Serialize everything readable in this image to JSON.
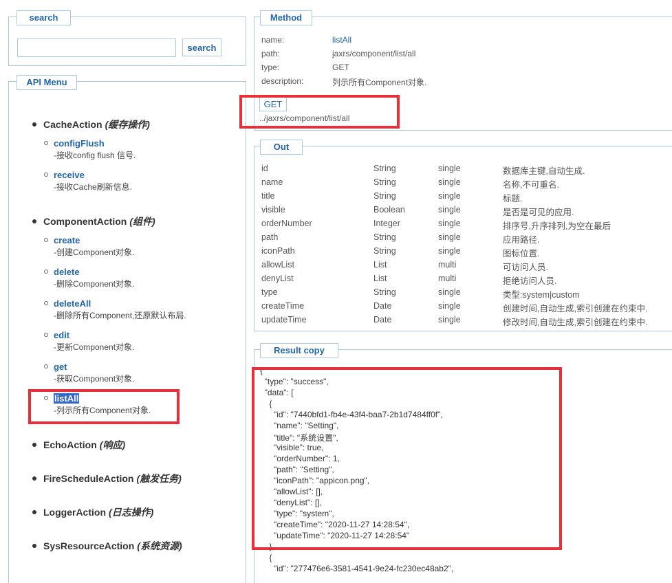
{
  "search": {
    "legend": "search",
    "input_value": "",
    "button_label": "search"
  },
  "api_menu": {
    "legend": "API Menu",
    "groups": [
      {
        "name": "CacheAction",
        "zh": "(缓存操作)"
      },
      {
        "name": "ComponentAction",
        "zh": "(组件)"
      },
      {
        "name": "EchoAction",
        "zh": "(响应)"
      },
      {
        "name": "FireScheduleAction",
        "zh": "(触发任务)"
      },
      {
        "name": "LoggerAction",
        "zh": "(日志操作)"
      },
      {
        "name": "SysResourceAction",
        "zh": "(系统资源)"
      }
    ],
    "cache_methods": [
      {
        "name": "configFlush",
        "desc": "-接收config flush 信号."
      },
      {
        "name": "receive",
        "desc": "-接收Cache刷新信息."
      }
    ],
    "component_methods": [
      {
        "name": "create",
        "desc": "-创建Component对象."
      },
      {
        "name": "delete",
        "desc": "-删除Component对象."
      },
      {
        "name": "deleteAll",
        "desc": "-删除所有Component,还原默认布局."
      },
      {
        "name": "edit",
        "desc": "-更新Component对象."
      },
      {
        "name": "get",
        "desc": "-获取Component对象."
      },
      {
        "name": "listAll",
        "desc": "-列示所有Component对象.",
        "selected": true
      }
    ]
  },
  "method": {
    "legend": "Method",
    "fields": [
      {
        "key": "name:",
        "value": "listAll",
        "link": true
      },
      {
        "key": "path:",
        "value": "jaxrs/component/list/all"
      },
      {
        "key": "type:",
        "value": "GET"
      },
      {
        "key": "description:",
        "value": "列示所有Component对象."
      }
    ],
    "get_button": "GET",
    "url": "../jaxrs/component/list/all"
  },
  "out": {
    "legend": "Out",
    "rows": [
      [
        "id",
        "String",
        "single",
        "数据库主键,自动生成."
      ],
      [
        "name",
        "String",
        "single",
        "名称,不可重名."
      ],
      [
        "title",
        "String",
        "single",
        "标题."
      ],
      [
        "visible",
        "Boolean",
        "single",
        "是否是可见的应用."
      ],
      [
        "orderNumber",
        "Integer",
        "single",
        "排序号,升序排列,为空在最后"
      ],
      [
        "path",
        "String",
        "single",
        "应用路径."
      ],
      [
        "iconPath",
        "String",
        "single",
        "图标位置."
      ],
      [
        "allowList",
        "List",
        "multi",
        "可访问人员."
      ],
      [
        "denyList",
        "List",
        "multi",
        "拒绝访问人员."
      ],
      [
        "type",
        "String",
        "single",
        "类型:system|custom"
      ],
      [
        "createTime",
        "Date",
        "single",
        "创建时间,自动生成,索引创建在约束中."
      ],
      [
        "updateTime",
        "Date",
        "single",
        "修改时间,自动生成,索引创建在约束中."
      ]
    ]
  },
  "result": {
    "legend": "Result copy",
    "lines": [
      "{",
      "  \"type\": \"success\",",
      "  \"data\": [",
      "    {",
      "      \"id\": \"7440bfd1-fb4e-43f4-baa7-2b1d7484ff0f\",",
      "      \"name\": \"Setting\",",
      "      \"title\": \"系统设置\",",
      "      \"visible\": true,",
      "      \"orderNumber\": 1,",
      "      \"path\": \"Setting\",",
      "      \"iconPath\": \"appicon.png\",",
      "      \"allowList\": [],",
      "      \"denyList\": [],",
      "      \"type\": \"system\",",
      "      \"createTime\": \"2020-11-27 14:28:54\",",
      "      \"updateTime\": \"2020-11-27 14:28:54\"",
      "    },",
      "    {",
      "      \"id\": \"277476e6-3581-4541-9e24-fc230ec48ab2\","
    ]
  },
  "colors": {
    "accent": "#2266aa",
    "border": "#a8c8e0",
    "highlight": "#e8303a",
    "selection": "#3366cc"
  }
}
